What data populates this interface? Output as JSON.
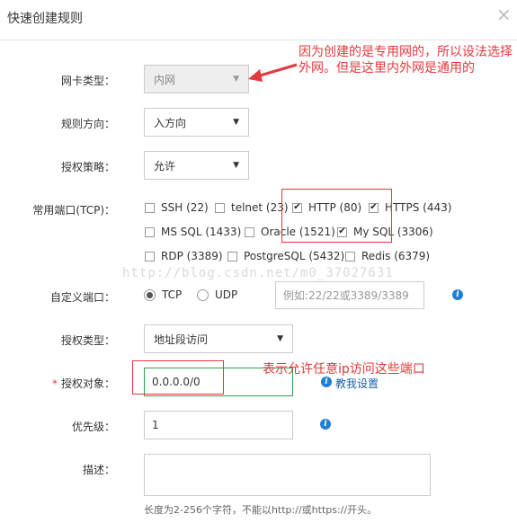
{
  "dialog": {
    "title": "快速创建规则",
    "close_icon": "×"
  },
  "form": {
    "nic_type": {
      "label": "网卡类型：",
      "value": "内网"
    },
    "direction": {
      "label": "规则方向：",
      "value": "入方向"
    },
    "policy": {
      "label": "授权策略：",
      "value": "允许"
    },
    "common_ports": {
      "label": "常用端口(TCP)：",
      "options": [
        {
          "label": "SSH (22)",
          "checked": false
        },
        {
          "label": "telnet (23)",
          "checked": false
        },
        {
          "label": "HTTP (80)",
          "checked": true
        },
        {
          "label": "HTTPS (443)",
          "checked": true
        },
        {
          "label": "MS SQL (1433)",
          "checked": false
        },
        {
          "label": "Oracle (1521)",
          "checked": false
        },
        {
          "label": "My SQL (3306)",
          "checked": true
        },
        {
          "label": "RDP (3389)",
          "checked": false
        },
        {
          "label": "PostgreSQL (5432)",
          "checked": false
        },
        {
          "label": "Redis (6379)",
          "checked": false
        }
      ]
    },
    "custom_port": {
      "label": "自定义端口：",
      "tcp_label": "TCP",
      "udp_label": "UDP",
      "selected": "TCP",
      "placeholder": "例如:22/22或3389/3389"
    },
    "auth_type": {
      "label": "授权类型：",
      "value": "地址段访问"
    },
    "auth_object": {
      "required_mark": "*",
      "label": "授权对象：",
      "value": "0.0.0.0/0",
      "help_link": "教我设置"
    },
    "priority": {
      "label": "优先级：",
      "value": "1"
    },
    "description": {
      "label": "描述：",
      "value": "",
      "hint": "长度为2-256个字符，不能以http://或https://开头。"
    }
  },
  "annotations": {
    "note_nic": "因为创建的是专用网的，所以设法选择外网。但是这里内外网是通用的",
    "note_ports": "表示允许任意ip访问这些端口",
    "watermark": "http://blog.csdn.net/m0_37027631"
  },
  "colors": {
    "annotation": "#e4393c",
    "highlight": "#2fa34a",
    "info": "#1f7fd6"
  }
}
